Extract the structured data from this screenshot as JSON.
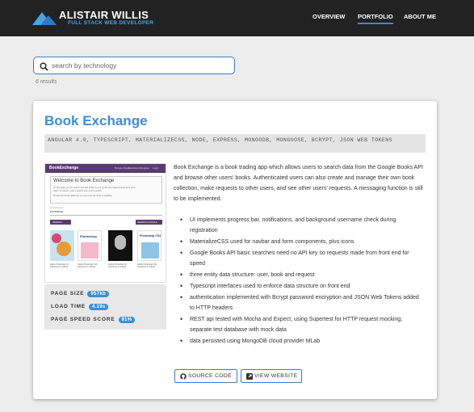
{
  "header": {
    "brand_name": "ALISTAIR WILLIS",
    "brand_subtitle": "FULL STACK WEB DEVELOPER",
    "nav": [
      {
        "label": "OVERVIEW",
        "active": false
      },
      {
        "label": "PORTFOLIO",
        "active": true
      },
      {
        "label": "ABOUT ME",
        "active": false
      }
    ],
    "accent_color": "#3b8bd6",
    "bar_color": "#222222"
  },
  "search": {
    "placeholder": "search by technology",
    "value": "",
    "icon": "search-icon",
    "results_text": "6 results"
  },
  "project": {
    "title": "Book Exchange",
    "tags": "ANGULAR 4.0, TYPESCRIPT, MATERIALIZECSS, NODE, EXPRESS, MONGODB, MONGOOSE, BCRYPT, JSON WEB TOKENS",
    "description": "Book Exchange is a book trading app which allows users to search data from the Google Books API and browse other users' books. Authenticated users can also create and manage their own book collection, make requests to other users, and see other users' requests. A messaging function is still to be implemented.",
    "features": [
      "UI implements progress bar, notifications, and background username check during registration",
      "MaterializeCSS used for navbar and form components, plus icons",
      "Google Books API basic searches need no API key so requests made from front end for speed",
      "three entity data structure: user, book and request",
      "Typescript interfaces used to enforce data structure on front end",
      "authentication implemented with Bcrypt password encryption and JSON Web Tokens added to HTTP headers",
      "REST api tested with Mocha and Expect, using Supertest for HTTP request mocking; separate test database with mock data",
      "data persisted using MongoDB cloud provider MLab"
    ],
    "stats": {
      "page_size_label": "PAGE SIZE",
      "page_size": "957kb",
      "load_time_label": "LOAD TIME",
      "load_time": "4.19s",
      "speed_label": "PAGE SPEED SCORE",
      "speed": "91%"
    },
    "buttons": {
      "source": "SOURCE CODE",
      "source_icon": "github-icon",
      "website": "VIEW WEBSITE",
      "website_icon": "external-link-icon"
    },
    "screenshot": {
      "app_name": "BookExchange",
      "nav_links": [
        "Browse Books",
        "Dashboard",
        "Register",
        "Login"
      ],
      "welcome": "Welcome to Book Exchange",
      "intro_1": "On this page you can search and add books to your profile and request books from other",
      "intro_2": "users. To search, enter a search term and hit search.",
      "intro_3": "Browse the books added by your peers to see what is available.",
      "field_1": "Search term",
      "field_2": "photoshop",
      "btn_left": "SEARCH",
      "btn_right": "SEARCH GOOGLE",
      "book_1": "Photoshop",
      "book_2": "Photoshop CS4",
      "caption_1": "Adobe Photoshop CC Classroom in a Book",
      "caption_2": "Adobe Photoshop CS6 Classroom in a Book",
      "caption_3": "Adobe Photoshop CC Classroom in a Book",
      "caption_4": "Adobe Photoshop CS4 Classroom in a Book"
    }
  }
}
